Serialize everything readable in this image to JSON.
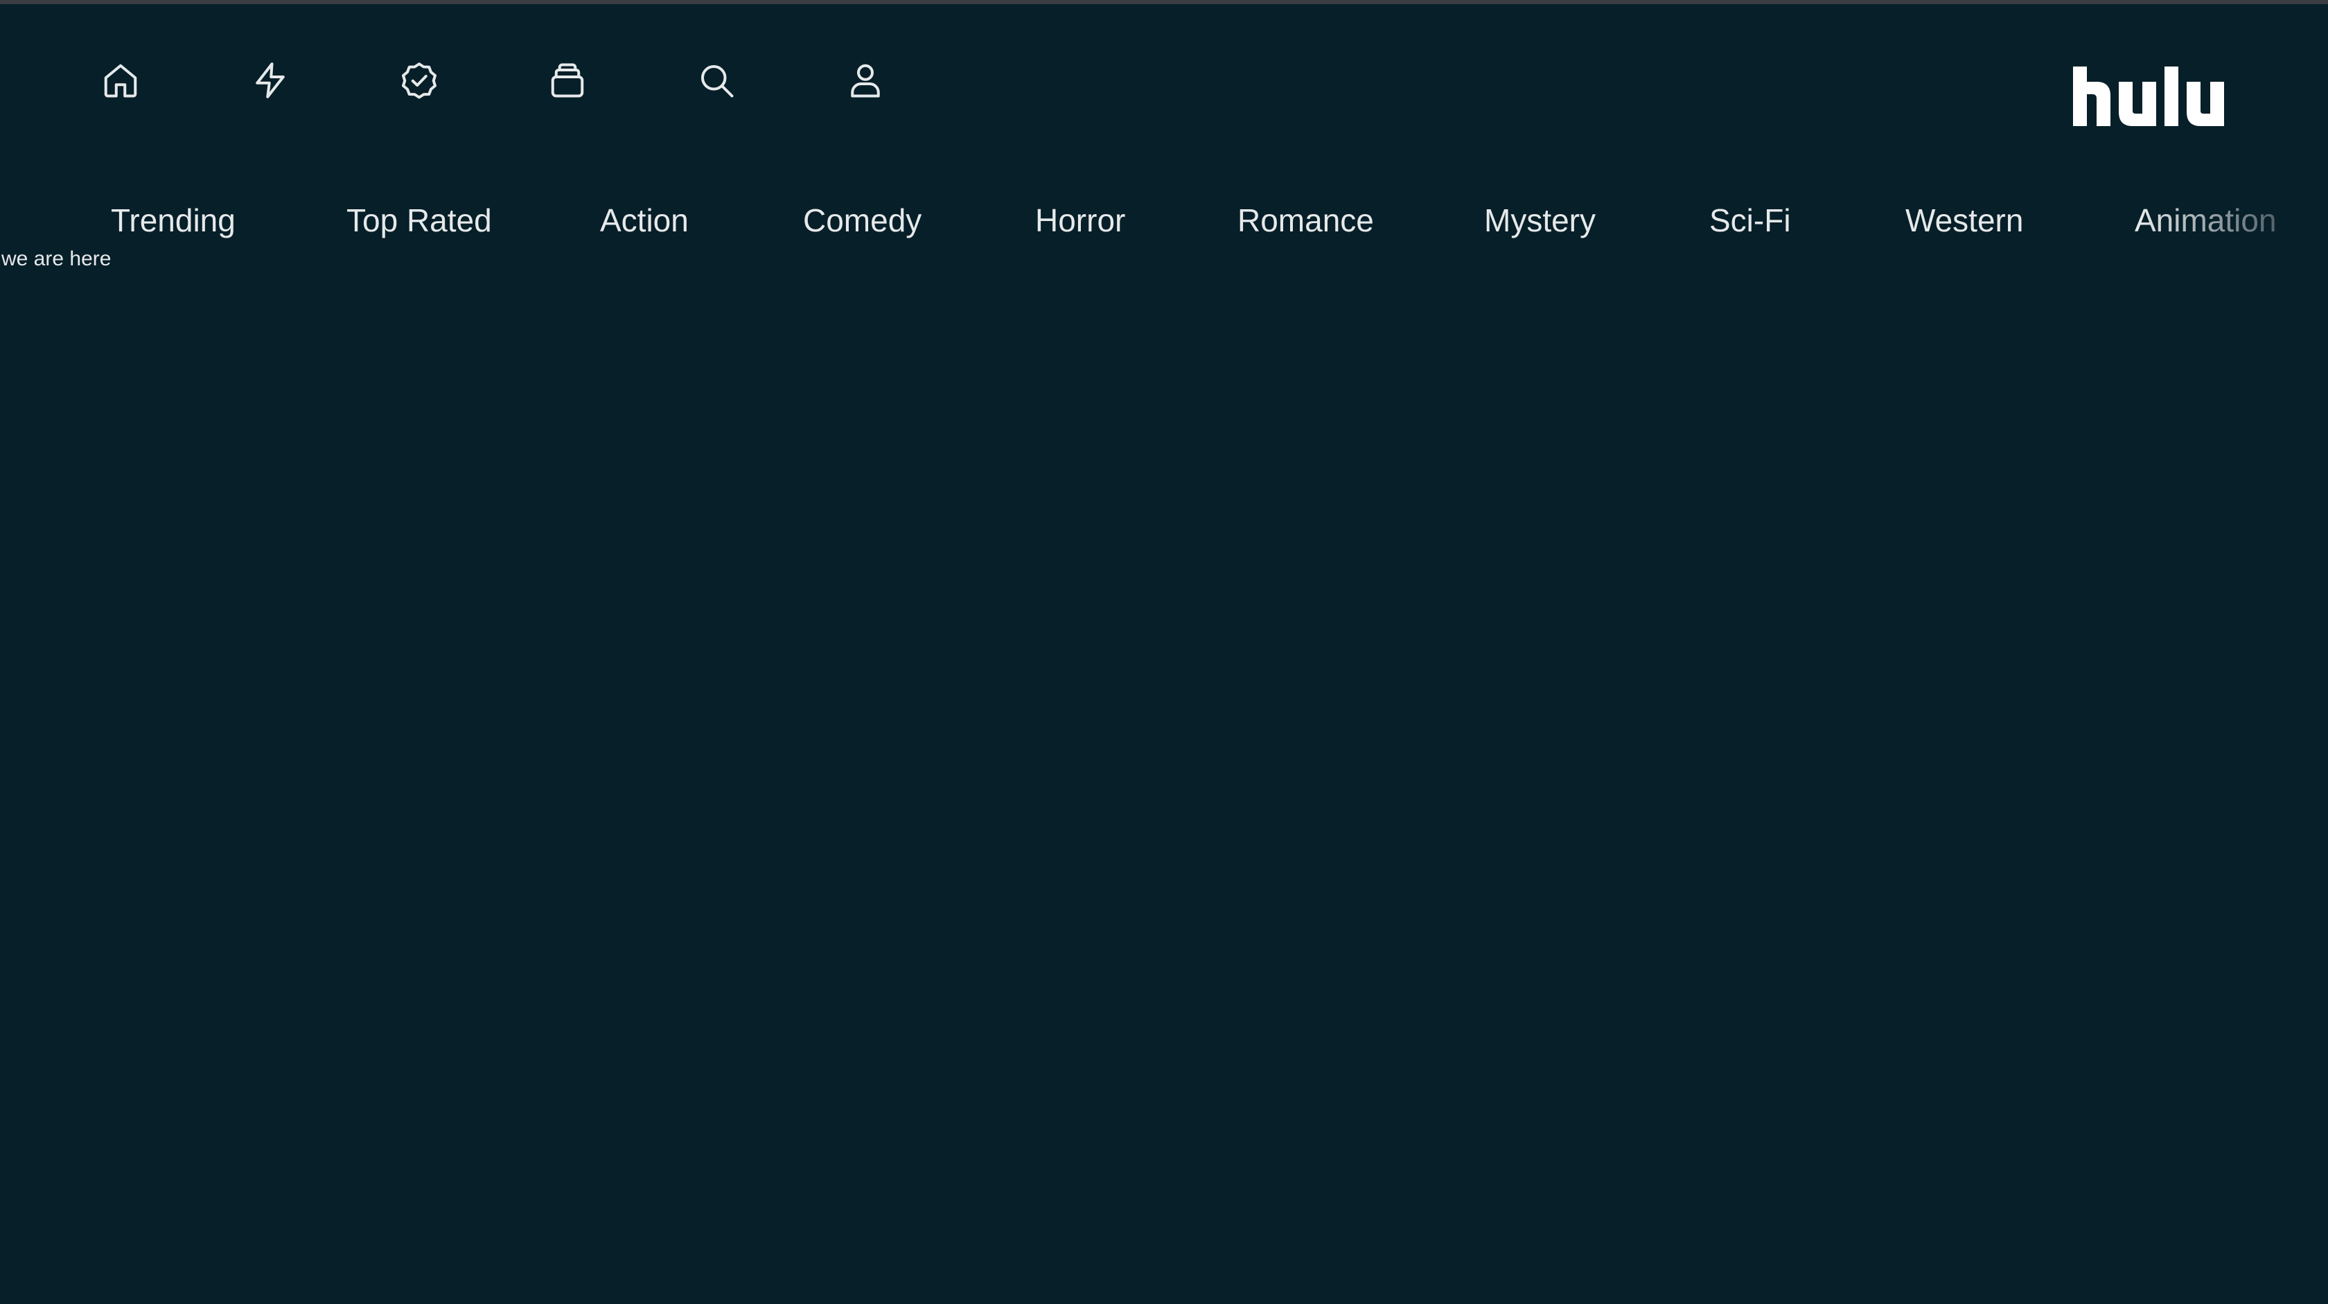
{
  "nav_icons": [
    {
      "name": "home-icon"
    },
    {
      "name": "lightning-icon"
    },
    {
      "name": "verified-badge-icon"
    },
    {
      "name": "stack-icon"
    },
    {
      "name": "search-icon"
    },
    {
      "name": "user-icon"
    }
  ],
  "brand": {
    "logo_text": "hulu",
    "logo_color": "#ffffff"
  },
  "genres": [
    {
      "label": "Trending"
    },
    {
      "label": "Top Rated"
    },
    {
      "label": "Action"
    },
    {
      "label": "Comedy"
    },
    {
      "label": "Horror"
    },
    {
      "label": "Romance"
    },
    {
      "label": "Mystery"
    },
    {
      "label": "Sci-Fi"
    },
    {
      "label": "Western"
    },
    {
      "label": "Animation"
    }
  ],
  "status": {
    "text": "we are here"
  },
  "colors": {
    "background": "#071f29",
    "text": "#e6e9ea",
    "top_border": "#3a3d42"
  }
}
